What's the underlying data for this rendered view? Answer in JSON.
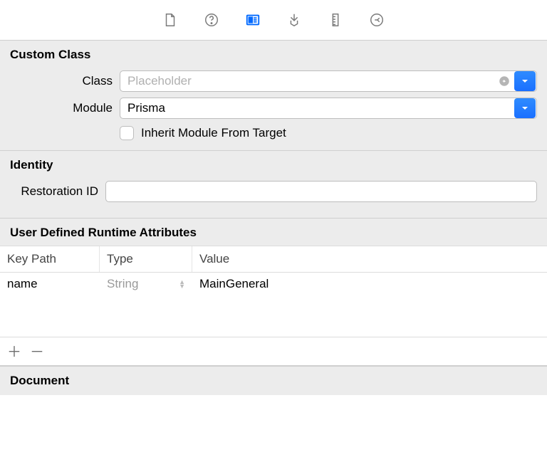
{
  "tabs": {
    "file": "file",
    "help": "help",
    "identity": "identity",
    "attributes": "attributes",
    "size": "size",
    "connections": "connections"
  },
  "customClass": {
    "header": "Custom Class",
    "classLabel": "Class",
    "classValue": "",
    "classPlaceholder": "Placeholder",
    "moduleLabel": "Module",
    "moduleValue": "Prisma",
    "inheritLabel": "Inherit Module From Target"
  },
  "identity": {
    "header": "Identity",
    "restorationLabel": "Restoration ID",
    "restorationValue": ""
  },
  "udra": {
    "header": "User Defined Runtime Attributes",
    "cols": {
      "key": "Key Path",
      "type": "Type",
      "value": "Value"
    },
    "rows": [
      {
        "key": "name",
        "type": "String",
        "value": "MainGeneral"
      }
    ]
  },
  "document": {
    "header": "Document"
  }
}
